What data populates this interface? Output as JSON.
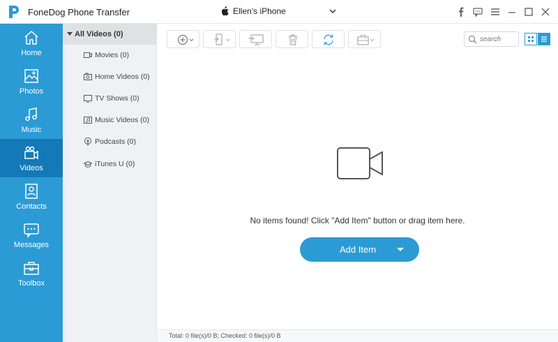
{
  "app": {
    "title": "FoneDog Phone Transfer"
  },
  "device": {
    "name": "Ellen’s iPhone"
  },
  "window_icons": [
    "facebook-icon",
    "feedback-icon",
    "menu-icon",
    "minimize-icon",
    "maximize-icon",
    "close-icon"
  ],
  "nav": {
    "items": [
      {
        "label": "Home",
        "icon": "home-icon"
      },
      {
        "label": "Photos",
        "icon": "photos-icon"
      },
      {
        "label": "Music",
        "icon": "music-icon"
      },
      {
        "label": "Videos",
        "icon": "videos-icon",
        "active": true
      },
      {
        "label": "Contacts",
        "icon": "contacts-icon"
      },
      {
        "label": "Messages",
        "icon": "messages-icon"
      },
      {
        "label": "Toolbox",
        "icon": "toolbox-icon"
      }
    ]
  },
  "categories": {
    "all": "All Videos (0)",
    "items": [
      {
        "label": "Movies (0)",
        "icon": "movie-icon"
      },
      {
        "label": "Home Videos (0)",
        "icon": "home-video-icon"
      },
      {
        "label": "TV Shows (0)",
        "icon": "tv-icon"
      },
      {
        "label": "Music Videos (0)",
        "icon": "music-video-icon"
      },
      {
        "label": "Podcasts (0)",
        "icon": "podcast-icon"
      },
      {
        "label": "iTunes U (0)",
        "icon": "itunes-u-icon"
      }
    ]
  },
  "toolbar": {
    "buttons": [
      "add-icon",
      "export-to-device-icon",
      "export-to-pc-icon",
      "delete-icon",
      "refresh-icon",
      "toolbox-icon"
    ],
    "search_placeholder": "search"
  },
  "empty": {
    "message": "No items found! Click \"Add Item\" button or drag item here.",
    "add_label": "Add Item"
  },
  "status": {
    "text": "Total: 0 file(s)/0 B; Checked: 0 file(s)/0 B"
  },
  "colors": {
    "accent": "#2b9bd5",
    "active_nav": "#1479b8",
    "panel_bg": "#f0f1f3"
  }
}
